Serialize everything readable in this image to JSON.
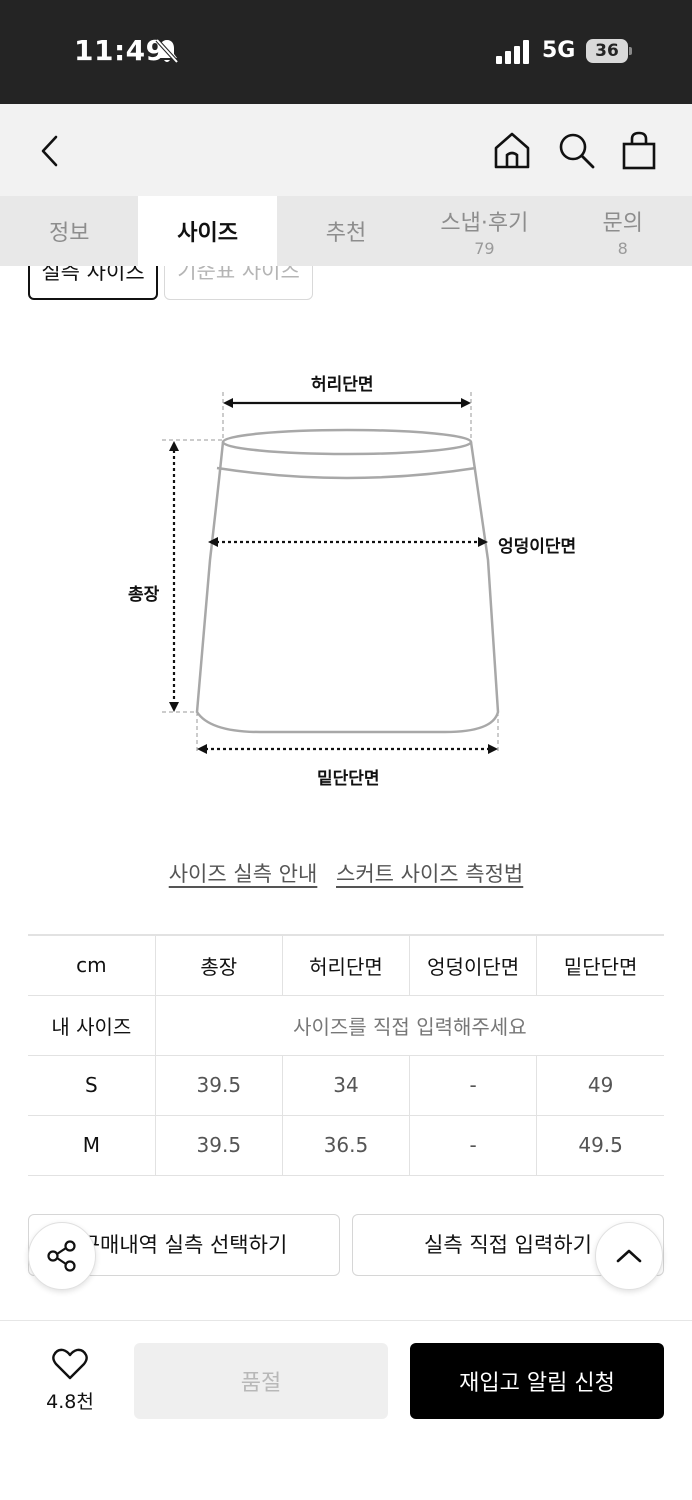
{
  "status_bar": {
    "time": "11:49",
    "network": "5G",
    "battery": "36"
  },
  "nav": {
    "icons": [
      "back-icon",
      "home-icon",
      "search-icon",
      "shopping-bag-icon"
    ]
  },
  "tabs": [
    {
      "label": "정보",
      "count": ""
    },
    {
      "label": "사이즈",
      "count": ""
    },
    {
      "label": "추천",
      "count": ""
    },
    {
      "label": "스냅·후기",
      "count": "79"
    },
    {
      "label": "문의",
      "count": "8"
    }
  ],
  "size_toggle": {
    "active": "실측 사이즈",
    "inactive": "기준표 사이즈"
  },
  "diagram": {
    "waist": "허리단면",
    "hip": "엉덩이단면",
    "length": "총장",
    "hem": "밑단단면"
  },
  "guide_links": {
    "measure_guide": "사이즈 실측 안내",
    "skirt_guide": "스커트 사이즈 측정법"
  },
  "size_table": {
    "headers": [
      "cm",
      "총장",
      "허리단면",
      "엉덩이단면",
      "밑단단면"
    ],
    "my_size": {
      "label": "내 사이즈",
      "hint": "사이즈를 직접 입력해주세요"
    },
    "rows": [
      {
        "size": "S",
        "values": [
          "39.5",
          "34",
          "-",
          "49"
        ]
      },
      {
        "size": "M",
        "values": [
          "39.5",
          "36.5",
          "-",
          "49.5"
        ]
      }
    ]
  },
  "actions": {
    "purchase_history": "구매내역 실측 선택하기",
    "direct_input": "실측 직접 입력하기"
  },
  "bottom_bar": {
    "likes": "4.8천",
    "soldout": "품절",
    "restock": "재입고 알림 신청"
  },
  "colors": {
    "primary": "#000000",
    "tab_bg": "#e8e8e8",
    "nav_bg": "#f2f2f2",
    "statusbar_bg": "#242424"
  }
}
